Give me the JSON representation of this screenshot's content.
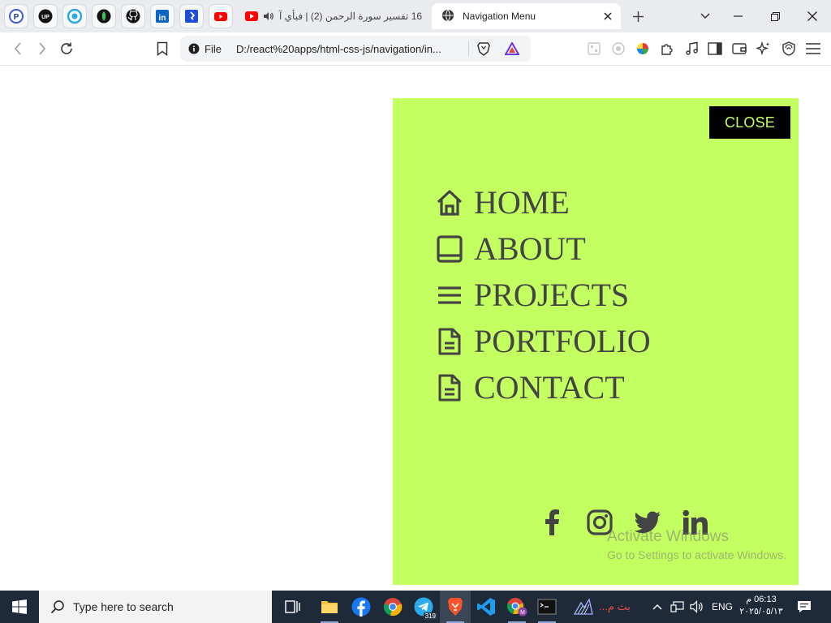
{
  "browser": {
    "pinned_tabs": [
      "pinned-app-1",
      "pinned-app-2",
      "pinned-app-3",
      "pinned-app-4",
      "github",
      "linkedin",
      "bitbucket",
      "youtube"
    ],
    "inactive_tab": {
      "title": "16 تفسير سورة الرحمن (2) | فبأي آ"
    },
    "active_tab": {
      "title": "Navigation Menu"
    },
    "address": {
      "scheme_label": "File",
      "url": "D:/react%20apps/html-css-js/navigation/in..."
    }
  },
  "page": {
    "close_label": "CLOSE",
    "menu": [
      {
        "label": "HOME",
        "icon": "home-icon"
      },
      {
        "label": "ABOUT",
        "icon": "book-icon"
      },
      {
        "label": "PROJECTS",
        "icon": "menu-lines-icon"
      },
      {
        "label": "PORTFOLIO",
        "icon": "document-icon"
      },
      {
        "label": "CONTACT",
        "icon": "document-icon"
      }
    ],
    "socials": [
      "facebook-icon",
      "instagram-icon",
      "twitter-icon",
      "linkedin-icon"
    ],
    "panel_color": "#c4ff61",
    "text_color": "#444444"
  },
  "watermark": {
    "line1": "Activate Windows",
    "line2": "Go to Settings to activate Windows."
  },
  "taskbar": {
    "search_placeholder": "Type here to search",
    "telegram_badge": "319",
    "tray_app_label": "بث م...",
    "language": "ENG",
    "time": "06:13 م",
    "date": "٢٠٢٥/٠٥/١٣"
  }
}
